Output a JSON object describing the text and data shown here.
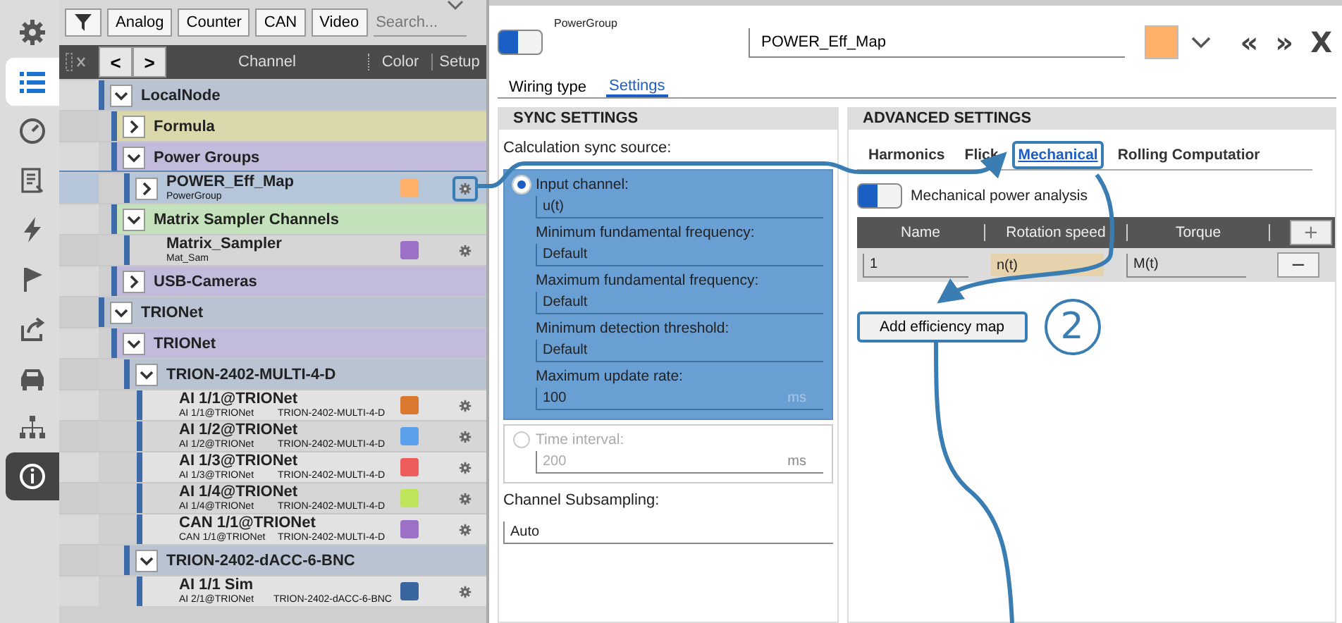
{
  "sidebar": {
    "items": [
      {
        "kind": "tool",
        "selected": false
      },
      {
        "kind": "tool",
        "selected": true
      },
      {
        "kind": "tool",
        "selected": false
      },
      {
        "kind": "tool",
        "selected": false
      },
      {
        "kind": "tool",
        "selected": false
      },
      {
        "kind": "tool",
        "selected": false
      },
      {
        "kind": "tool",
        "selected": false
      },
      {
        "kind": "tool",
        "selected": false
      },
      {
        "kind": "tool",
        "selected": false
      },
      {
        "kind": "info",
        "selected": false
      }
    ]
  },
  "toolbar": {
    "filters": [
      "Analog",
      "Counter",
      "CAN",
      "Video"
    ],
    "search": {
      "placeholder": "Search..."
    }
  },
  "channel_header": {
    "back": "<",
    "forward": ">",
    "columns": [
      "Channel",
      "Color",
      "Setup"
    ]
  },
  "tree": [
    {
      "label": "LocalNode",
      "expanded": true,
      "color": "#b9c3d1",
      "children": [
        {
          "label": "Formula",
          "expanded": false,
          "color": "#dbd8ab"
        },
        {
          "label": "Power Groups",
          "expanded": true,
          "color": "#c3bbdb",
          "children": [
            {
              "kind": "channel",
              "label": "POWER_Eff_Map",
              "sub": "PowerGroup",
              "expandable": true,
              "selected": true,
              "highlighted": true,
              "color": "#ffb06a"
            }
          ]
        },
        {
          "label": "Matrix Sampler Channels",
          "expanded": true,
          "color": "#c3e2bb",
          "children": [
            {
              "kind": "channel",
              "label": "Matrix_Sampler",
              "sub": "Mat_Sam",
              "expandable": false,
              "selected": false,
              "highlighted": false,
              "color": "#9b70c6"
            }
          ]
        },
        {
          "label": "USB-Cameras",
          "expanded": false,
          "color": "#c3bbdb"
        }
      ]
    },
    {
      "label": "TRIONet",
      "expanded": true,
      "color": "#b9c3d1",
      "children": [
        {
          "label": "TRIONet",
          "expanded": true,
          "color": "#c3bbdb",
          "children": [
            {
              "label": "TRION-2402-MULTI-4-D",
              "expanded": true,
              "color": "#b9c3d1",
              "children": [
                {
                  "kind": "channel",
                  "label": "AI 1/1@TRIONet",
                  "sub": "AI 1/1@TRIONet",
                  "device": "TRION-2402-MULTI-4-D",
                  "expandable": false,
                  "selected": false,
                  "highlighted": false,
                  "color": "#d9782e"
                },
                {
                  "kind": "channel",
                  "label": "AI 1/2@TRIONet",
                  "sub": "AI 1/2@TRIONet",
                  "device": "TRION-2402-MULTI-4-D",
                  "expandable": false,
                  "selected": false,
                  "highlighted": false,
                  "color": "#5aa0ea"
                },
                {
                  "kind": "channel",
                  "label": "AI 1/3@TRIONet",
                  "sub": "AI 1/3@TRIONet",
                  "device": "TRION-2402-MULTI-4-D",
                  "expandable": false,
                  "selected": false,
                  "highlighted": false,
                  "color": "#ee5c5c"
                },
                {
                  "kind": "channel",
                  "label": "AI 1/4@TRIONet",
                  "sub": "AI 1/4@TRIONet",
                  "device": "TRION-2402-MULTI-4-D",
                  "expandable": false,
                  "selected": false,
                  "highlighted": false,
                  "color": "#bde45a"
                },
                {
                  "kind": "channel",
                  "label": "CAN 1/1@TRIONet",
                  "sub": "CAN 1/1@TRIONet",
                  "device": "TRION-2402-MULTI-4-D",
                  "expandable": false,
                  "selected": false,
                  "highlighted": false,
                  "color": "#9b70c6"
                }
              ]
            },
            {
              "label": "TRION-2402-dACC-6-BNC",
              "expanded": true,
              "color": "#b9c3d1",
              "children": [
                {
                  "kind": "channel",
                  "label": "AI 1/1 Sim",
                  "sub": "AI 2/1@TRIONet",
                  "device": "TRION-2402-dACC-6-BNC",
                  "expandable": false,
                  "selected": false,
                  "highlighted": false,
                  "color": "#3a66a0"
                }
              ]
            }
          ]
        }
      ]
    }
  ],
  "editor": {
    "toggle_on": true,
    "type": "PowerGroup",
    "name": "POWER_Eff_Map",
    "color": "#ffb06a",
    "nav": [
      "«",
      "»",
      "X"
    ],
    "tabs": [
      {
        "label": "Wiring type",
        "selected": false
      },
      {
        "label": "Settings",
        "selected": true
      }
    ]
  },
  "sync_settings": {
    "title": "SYNC SETTINGS",
    "source_label": "Calculation sync source:",
    "options": [
      {
        "label": "Input channel:",
        "selected": true,
        "value": "u(t)",
        "fields": [
          {
            "label": "Minimum fundamental frequency:",
            "value": "Default"
          },
          {
            "label": "Maximum fundamental frequency:",
            "value": "Default"
          },
          {
            "label": "Minimum detection threshold:",
            "value": "Default"
          },
          {
            "label": "Maximum update rate:",
            "value": "100",
            "unit": "ms"
          }
        ]
      },
      {
        "label": "Time interval:",
        "selected": false,
        "value": "200",
        "unit": "ms"
      }
    ],
    "subsampling": {
      "label": "Channel Subsampling:",
      "value": "Auto"
    }
  },
  "advanced_settings": {
    "title": "ADVANCED SETTINGS",
    "tabs": [
      {
        "label": "Harmonics",
        "selected": false,
        "highlighted": false
      },
      {
        "label": "Flick",
        "selected": false,
        "highlighted": false
      },
      {
        "label": "Mechanical",
        "selected": true,
        "highlighted": true
      },
      {
        "label": "Rolling Computatior",
        "selected": false,
        "highlighted": false
      }
    ],
    "toggle": {
      "on": true,
      "label": "Mechanical power analysis"
    },
    "table": {
      "columns": [
        "Name",
        "Rotation speed",
        "Torque"
      ],
      "add": "+",
      "rows": [
        {
          "name": "1",
          "rotation_speed": "n(t)",
          "torque": "M(t)",
          "remove": "−"
        }
      ]
    },
    "button": {
      "label": "Add efficiency map",
      "highlighted": true
    },
    "step_marker": "2"
  }
}
